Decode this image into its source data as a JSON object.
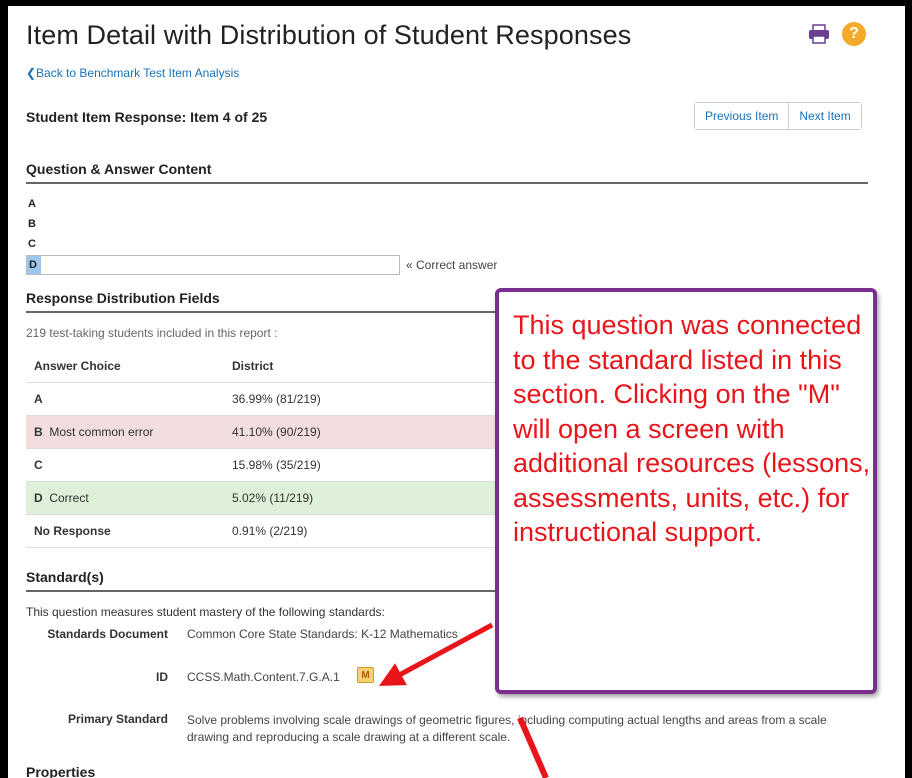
{
  "header": {
    "title": "Item Detail with Distribution of Student Responses",
    "back_link": "❮Back to Benchmark Test Item Analysis",
    "icons": [
      "printer-icon",
      "help-icon"
    ],
    "help_glyph": "?"
  },
  "item": {
    "heading": "Student Item Response: Item 4 of 25",
    "previous_label": "Previous Item",
    "next_label": "Next Item"
  },
  "qa": {
    "heading": "Question & Answer Content",
    "choices": [
      "A",
      "B",
      "C",
      "D"
    ],
    "correct_note": "« Correct answer"
  },
  "distribution": {
    "heading": "Response Distribution Fields",
    "students_note": "219 test-taking students included in this report :",
    "columns": [
      "Answer Choice",
      "District"
    ],
    "rows": [
      {
        "choice": "A",
        "label": "",
        "district": "36.99% (81/219)"
      },
      {
        "choice": "B",
        "label": "Most common error",
        "district": "41.10% (90/219)"
      },
      {
        "choice": "C",
        "label": "",
        "district": "15.98% (35/219)"
      },
      {
        "choice": "D",
        "label": "Correct",
        "district": "5.02% (11/219)"
      },
      {
        "choice": "No Response",
        "label": "",
        "district": "0.91% (2/219)"
      }
    ]
  },
  "standards": {
    "heading": "Standard(s)",
    "intro": "This question measures student mastery of the following standards:",
    "document_label": "Standards Document",
    "document_value": "Common Core State Standards: K-12 Mathematics",
    "id_label": "ID",
    "id_value": "CCSS.Math.Content.7.G.A.1",
    "m_glyph": "M",
    "primary_label": "Primary Standard",
    "primary_value": "Solve problems involving scale drawings of geometric figures, including computing actual lengths and areas from a scale drawing and reproducing a scale drawing at a different scale."
  },
  "next_section": "Properties",
  "callout": {
    "text": "This question was connected to the standard listed in this section.  Clicking on the \"M\" will open a screen with additional resources (lessons, assessments, units, etc.) for instructional support."
  },
  "colors": {
    "link": "#1a73b8",
    "error_row": "#f2dede",
    "correct_row": "#dff0d8",
    "callout_border": "#7b2e8e",
    "callout_text": "#e8151b",
    "arrow": "#e8151b"
  }
}
